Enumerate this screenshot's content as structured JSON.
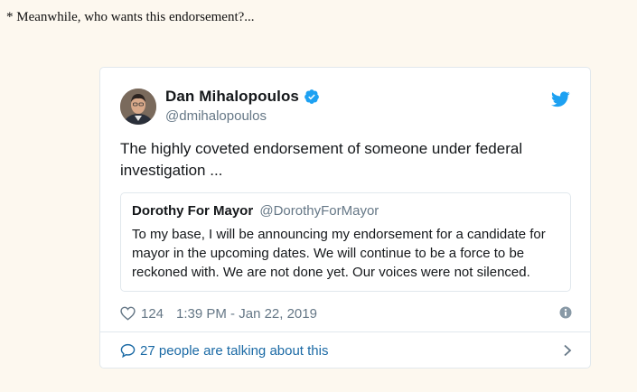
{
  "intro_text": "* Meanwhile, who wants this endorsement?...",
  "tweet": {
    "display_name": "Dan Mihalopoulos",
    "handle": "@dmihalopoulos",
    "text": "The highly coveted endorsement of someone under federal investigation ...",
    "quoted_tweet": {
      "display_name": "Dorothy For Mayor",
      "handle": "@DorothyForMayor",
      "text": "To my base, I will be announcing my endorsement for a candidate for mayor in the upcoming dates. We will continue to be a force to be reckoned with. We are not done yet. Our voices were not silenced."
    },
    "like_count": "124",
    "timestamp": "1:39 PM - Jan 22, 2019",
    "conversation_label": "27 people are talking about this"
  },
  "icons": {
    "verified": "verified-badge-icon",
    "brand": "twitter-bird-icon",
    "like": "heart-icon",
    "info": "info-icon",
    "reply": "speech-bubble-icon",
    "more": "chevron-right-icon"
  },
  "colors": {
    "page_background": "#fdf8ef",
    "twitter_blue": "#1da1f2",
    "link_blue": "#1b6aa5",
    "secondary_text": "#657786",
    "border": "#e1e8ed"
  }
}
